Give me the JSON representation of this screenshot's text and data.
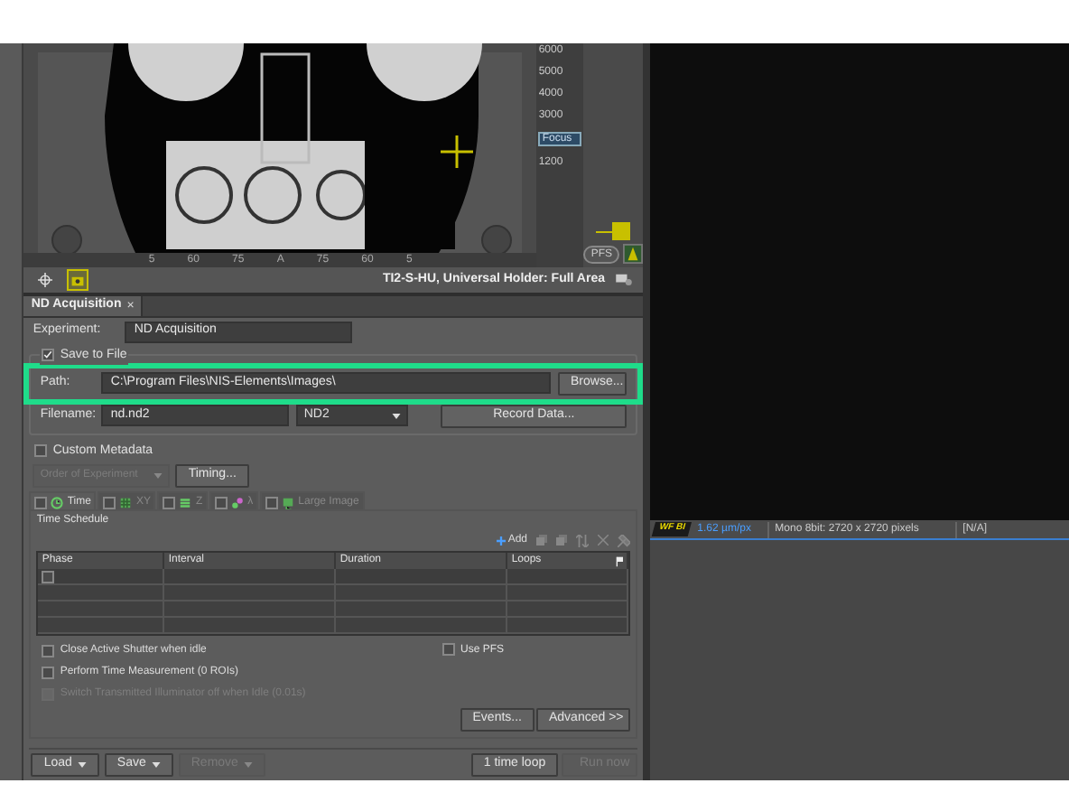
{
  "viewer": {
    "scale_labels": [
      {
        "text": "6000",
        "kind": "tick"
      },
      {
        "text": "5000",
        "kind": "tick"
      },
      {
        "text": "4000",
        "kind": "tick"
      },
      {
        "text": "3000",
        "kind": "tick"
      },
      {
        "text": "Focus",
        "kind": "marker"
      },
      {
        "text": "1200",
        "kind": "tick"
      }
    ],
    "pfs_button": "PFS",
    "ruler_labels": [
      "5",
      "60",
      "75",
      "A",
      "75",
      "60",
      "5"
    ],
    "tools": [
      {
        "kind": "crosshair",
        "selected": false
      },
      {
        "kind": "camera",
        "selected": true
      }
    ],
    "stage_info": "TI2-S-HU, Universal Holder: Full Area"
  },
  "panel_tab": {
    "label": "ND Acquisition",
    "close": "×"
  },
  "experiment": {
    "label": "Experiment:",
    "value": "ND Acquisition"
  },
  "save_to_file": {
    "label": "Save to File",
    "checked": true
  },
  "path": {
    "label": "Path:",
    "value": "C:\\Program Files\\NIS-Elements\\Images\\",
    "button": "Browse...",
    "highlighted": true
  },
  "filename": {
    "label": "Filename:",
    "value": "nd.nd2",
    "format": "ND2",
    "button": "Record Data..."
  },
  "custom_metadata": {
    "label": "Custom Metadata",
    "checked": false
  },
  "order": {
    "label": "Order of Experiment",
    "disabled": true
  },
  "timing_button": "Timing...",
  "dimension_tabs": [
    {
      "label": "Time",
      "kind": "time",
      "checked": false,
      "selected": true
    },
    {
      "label": "XY",
      "kind": "xy",
      "checked": false,
      "selected": false
    },
    {
      "label": "Z",
      "kind": "z",
      "checked": false,
      "selected": false
    },
    {
      "label": "λ",
      "kind": "lambda",
      "checked": false,
      "selected": false
    },
    {
      "label": "Large Image",
      "kind": "large",
      "checked": false,
      "selected": false
    }
  ],
  "time_schedule": {
    "title": "Time Schedule",
    "add_button": "Add",
    "columns": [
      "Phase",
      "Interval",
      "Duration",
      "Loops"
    ],
    "rows": [
      {
        "kind": "entry",
        "checked": false
      },
      {
        "kind": "blank"
      },
      {
        "kind": "blank"
      },
      {
        "kind": "blank"
      }
    ]
  },
  "options": [
    {
      "label": "Close Active Shutter when idle",
      "checked": false,
      "disabled": false
    },
    {
      "label": "Perform Time Measurement (0 ROIs)",
      "checked": false,
      "disabled": false
    },
    {
      "label": "Switch Transmitted Illuminator off when Idle (0.01s)",
      "checked": false,
      "disabled": true
    }
  ],
  "use_pfs": {
    "label": "Use PFS",
    "checked": false
  },
  "buttons": [
    "Events...",
    "Advanced >>"
  ],
  "bottom_bar": {
    "left": [
      {
        "label": "Load",
        "disabled": false
      },
      {
        "label": "Save",
        "disabled": false
      },
      {
        "label": "Remove",
        "disabled": true
      }
    ],
    "right": [
      {
        "label": "1 time loop",
        "disabled": false
      },
      {
        "label": "Run now",
        "disabled": true
      }
    ]
  },
  "status_bar": {
    "badge": "WF BI",
    "scale": "1.62 µm/px",
    "image_info": "Mono 8bit: 2720 x 2720 pixels",
    "value": "[N/A]"
  }
}
